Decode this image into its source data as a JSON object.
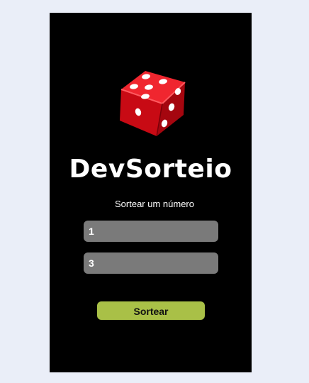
{
  "app": {
    "brand": "DevSorteio",
    "logo_icon": "dice-icon"
  },
  "form": {
    "title": "Sortear um número",
    "min_value": "1",
    "max_value": "3",
    "submit_label": "Sortear"
  },
  "colors": {
    "page_background": "#eaeef8",
    "card_background": "#000000",
    "input_background": "#7a7a7a",
    "button_background": "#a9c047",
    "dice_red": "#e5101b"
  }
}
